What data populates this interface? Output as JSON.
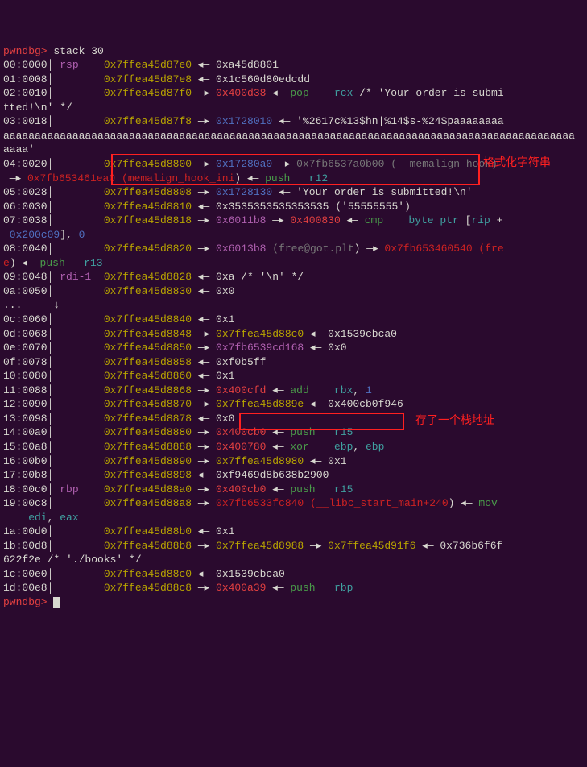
{
  "prompt": "pwndbg>",
  "command": "stack 30",
  "rows": [
    {
      "idx": "00:0000",
      "reg": "rsp",
      "addr": "0x7ffea45d87e0",
      "rest": [
        {
          "t": "◂— ",
          "c": "white"
        },
        {
          "t": "0xa45d8801",
          "c": "white"
        }
      ]
    },
    {
      "idx": "01:0008",
      "reg": "",
      "addr": "0x7ffea45d87e8",
      "rest": [
        {
          "t": "◂— ",
          "c": "white"
        },
        {
          "t": "0x1c560d80edcdd",
          "c": "white"
        }
      ]
    },
    {
      "idx": "02:0010",
      "reg": "",
      "addr": "0x7ffea45d87f0",
      "rest": [
        {
          "t": "—▸ ",
          "c": "white"
        },
        {
          "t": "0x400d38",
          "c": "red"
        },
        {
          "t": " ◂— ",
          "c": "white"
        },
        {
          "t": "pop    ",
          "c": "green"
        },
        {
          "t": "rcx",
          "c": "cyan"
        },
        {
          "t": " /* 'Your order is submi",
          "c": "white"
        }
      ],
      "wrap": "tted!\\n' */"
    },
    {
      "idx": "03:0018",
      "reg": "",
      "addr": "0x7ffea45d87f8",
      "rest": [
        {
          "t": "—▸ ",
          "c": "white"
        },
        {
          "t": "0x1728010",
          "c": "blue"
        },
        {
          "t": " ◂— ",
          "c": "white"
        },
        {
          "t": "'%2617c%13$hn|%14$s-%24$paaaaaaaa",
          "c": "white"
        }
      ],
      "wrap": "aaaaaaaaaaaaaaaaaaaaaaaaaaaaaaaaaaaaaaaaaaaaaaaaaaaaaaaaaaaaaaaaaaaaaaaaaaaaaaaaaaaaaaaaaaa\naaaa'"
    },
    {
      "idx": "04:0020",
      "reg": "",
      "addr": "0x7ffea45d8800",
      "rest": [
        {
          "t": "—▸ ",
          "c": "white"
        },
        {
          "t": "0x17280a0",
          "c": "blue"
        },
        {
          "t": " —▸ ",
          "c": "white"
        },
        {
          "t": "0x7fb6537a0b00",
          "c": "dim"
        },
        {
          "t": " (",
          "c": "dim"
        },
        {
          "t": "__memalign_hook",
          "c": "dim"
        },
        {
          "t": ")",
          "c": "dim"
        }
      ],
      "wrap2": [
        {
          "t": " —▸ ",
          "c": "white"
        },
        {
          "t": "0x7fb653461ea0",
          "c": "darkred"
        },
        {
          "t": " (",
          "c": "darkred"
        },
        {
          "t": "memalign_hook_ini",
          "c": "darkred"
        },
        {
          "t": ") ◂— ",
          "c": "white"
        },
        {
          "t": "push   ",
          "c": "green"
        },
        {
          "t": "r12",
          "c": "cyan"
        }
      ]
    },
    {
      "idx": "05:0028",
      "reg": "",
      "addr": "0x7ffea45d8808",
      "rest": [
        {
          "t": "—▸ ",
          "c": "white"
        },
        {
          "t": "0x1728130",
          "c": "blue"
        },
        {
          "t": " ◂— ",
          "c": "white"
        },
        {
          "t": "'Your order is submitted!\\n'",
          "c": "white"
        }
      ]
    },
    {
      "idx": "06:0030",
      "reg": "",
      "addr": "0x7ffea45d8810",
      "rest": [
        {
          "t": "◂— ",
          "c": "white"
        },
        {
          "t": "0x3535353535353535",
          "c": "white"
        },
        {
          "t": " (",
          "c": "white"
        },
        {
          "t": "'55555555'",
          "c": "white"
        },
        {
          "t": ")",
          "c": "white"
        }
      ]
    },
    {
      "idx": "07:0038",
      "reg": "",
      "addr": "0x7ffea45d8818",
      "rest": [
        {
          "t": "—▸ ",
          "c": "white"
        },
        {
          "t": "0x6011b8",
          "c": "magenta"
        },
        {
          "t": " —▸ ",
          "c": "white"
        },
        {
          "t": "0x400830",
          "c": "red"
        },
        {
          "t": " ◂— ",
          "c": "white"
        },
        {
          "t": "cmp    ",
          "c": "green"
        },
        {
          "t": "byte ptr ",
          "c": "cyan"
        },
        {
          "t": "[",
          "c": "white"
        },
        {
          "t": "rip ",
          "c": "cyan"
        },
        {
          "t": "+",
          "c": "white"
        }
      ],
      "wrap2": [
        {
          "t": " 0x200c09",
          "c": "blue"
        },
        {
          "t": "], ",
          "c": "white"
        },
        {
          "t": "0",
          "c": "blue"
        }
      ]
    },
    {
      "idx": "08:0040",
      "reg": "",
      "addr": "0x7ffea45d8820",
      "rest": [
        {
          "t": "—▸ ",
          "c": "white"
        },
        {
          "t": "0x6013b8",
          "c": "magenta"
        },
        {
          "t": " (",
          "c": "dim"
        },
        {
          "t": "free@got.plt",
          "c": "dim"
        },
        {
          "t": ") —▸ ",
          "c": "white"
        },
        {
          "t": "0x7fb653460540",
          "c": "darkred"
        },
        {
          "t": " (",
          "c": "darkred"
        },
        {
          "t": "fre",
          "c": "darkred"
        }
      ],
      "wrap2": [
        {
          "t": "e",
          "c": "darkred"
        },
        {
          "t": ") ◂— ",
          "c": "white"
        },
        {
          "t": "push   ",
          "c": "green"
        },
        {
          "t": "r13",
          "c": "cyan"
        }
      ]
    },
    {
      "idx": "09:0048",
      "reg": "rdi-1",
      "addr": "0x7ffea45d8828",
      "rest": [
        {
          "t": "◂— ",
          "c": "white"
        },
        {
          "t": "0xa",
          "c": "white"
        },
        {
          "t": " /* '\\n' */",
          "c": "white"
        }
      ]
    },
    {
      "idx": "0a:0050",
      "reg": "",
      "addr": "0x7ffea45d8830",
      "rest": [
        {
          "t": "◂— ",
          "c": "white"
        },
        {
          "t": "0x0",
          "c": "white"
        }
      ]
    },
    {
      "idx": "...",
      "reg": "",
      "addr": "↓",
      "rest": []
    },
    {
      "idx": "0c:0060",
      "reg": "",
      "addr": "0x7ffea45d8840",
      "rest": [
        {
          "t": "◂— ",
          "c": "white"
        },
        {
          "t": "0x1",
          "c": "white"
        }
      ]
    },
    {
      "idx": "0d:0068",
      "reg": "",
      "addr": "0x7ffea45d8848",
      "rest": [
        {
          "t": "—▸ ",
          "c": "white"
        },
        {
          "t": "0x7ffea45d88c0",
          "c": "yellow"
        },
        {
          "t": " ◂— ",
          "c": "white"
        },
        {
          "t": "0x1539cbca0",
          "c": "white"
        }
      ]
    },
    {
      "idx": "0e:0070",
      "reg": "",
      "addr": "0x7ffea45d8850",
      "rest": [
        {
          "t": "—▸ ",
          "c": "white"
        },
        {
          "t": "0x7fb6539cd168",
          "c": "magenta"
        },
        {
          "t": " ◂— ",
          "c": "white"
        },
        {
          "t": "0x0",
          "c": "white"
        }
      ]
    },
    {
      "idx": "0f:0078",
      "reg": "",
      "addr": "0x7ffea45d8858",
      "rest": [
        {
          "t": "◂— ",
          "c": "white"
        },
        {
          "t": "0xf0b5ff",
          "c": "white"
        }
      ]
    },
    {
      "idx": "10:0080",
      "reg": "",
      "addr": "0x7ffea45d8860",
      "rest": [
        {
          "t": "◂— ",
          "c": "white"
        },
        {
          "t": "0x1",
          "c": "white"
        }
      ]
    },
    {
      "idx": "11:0088",
      "reg": "",
      "addr": "0x7ffea45d8868",
      "rest": [
        {
          "t": "—▸ ",
          "c": "white"
        },
        {
          "t": "0x400cfd",
          "c": "red"
        },
        {
          "t": " ◂— ",
          "c": "white"
        },
        {
          "t": "add    ",
          "c": "green"
        },
        {
          "t": "rbx",
          "c": "cyan"
        },
        {
          "t": ", ",
          "c": "white"
        },
        {
          "t": "1",
          "c": "blue"
        }
      ]
    },
    {
      "idx": "12:0090",
      "reg": "",
      "addr": "0x7ffea45d8870",
      "rest": [
        {
          "t": "—▸ ",
          "c": "white"
        },
        {
          "t": "0x7ffea45d889e",
          "c": "yellow"
        },
        {
          "t": " ◂— ",
          "c": "white"
        },
        {
          "t": "0x400cb0f946",
          "c": "white"
        }
      ]
    },
    {
      "idx": "13:0098",
      "reg": "",
      "addr": "0x7ffea45d8878",
      "rest": [
        {
          "t": "◂— ",
          "c": "white"
        },
        {
          "t": "0x0",
          "c": "white"
        }
      ]
    },
    {
      "idx": "14:00a0",
      "reg": "",
      "addr": "0x7ffea45d8880",
      "rest": [
        {
          "t": "—▸ ",
          "c": "white"
        },
        {
          "t": "0x400cb0",
          "c": "red"
        },
        {
          "t": " ◂— ",
          "c": "white"
        },
        {
          "t": "push   ",
          "c": "green"
        },
        {
          "t": "r15",
          "c": "cyan"
        }
      ]
    },
    {
      "idx": "15:00a8",
      "reg": "",
      "addr": "0x7ffea45d8888",
      "rest": [
        {
          "t": "—▸ ",
          "c": "white"
        },
        {
          "t": "0x400780",
          "c": "red"
        },
        {
          "t": " ◂— ",
          "c": "white"
        },
        {
          "t": "xor    ",
          "c": "green"
        },
        {
          "t": "ebp",
          "c": "cyan"
        },
        {
          "t": ", ",
          "c": "white"
        },
        {
          "t": "ebp",
          "c": "cyan"
        }
      ]
    },
    {
      "idx": "16:00b0",
      "reg": "",
      "addr": "0x7ffea45d8890",
      "rest": [
        {
          "t": "—▸ ",
          "c": "white"
        },
        {
          "t": "0x7ffea45d8980",
          "c": "yellow"
        },
        {
          "t": " ◂— ",
          "c": "white"
        },
        {
          "t": "0x1",
          "c": "white"
        }
      ]
    },
    {
      "idx": "17:00b8",
      "reg": "",
      "addr": "0x7ffea45d8898",
      "rest": [
        {
          "t": "◂— ",
          "c": "white"
        },
        {
          "t": "0xf9469d8b638b2900",
          "c": "white"
        }
      ]
    },
    {
      "idx": "18:00c0",
      "reg": "rbp",
      "addr": "0x7ffea45d88a0",
      "rest": [
        {
          "t": "—▸ ",
          "c": "white"
        },
        {
          "t": "0x400cb0",
          "c": "red"
        },
        {
          "t": " ◂— ",
          "c": "white"
        },
        {
          "t": "push   ",
          "c": "green"
        },
        {
          "t": "r15",
          "c": "cyan"
        }
      ]
    },
    {
      "idx": "19:00c8",
      "reg": "",
      "addr": "0x7ffea45d88a8",
      "rest": [
        {
          "t": "—▸ ",
          "c": "white"
        },
        {
          "t": "0x7fb6533fc840",
          "c": "darkred"
        },
        {
          "t": " (",
          "c": "darkred"
        },
        {
          "t": "__libc_start_main+240",
          "c": "darkred"
        },
        {
          "t": ") ◂— ",
          "c": "white"
        },
        {
          "t": "mov",
          "c": "green"
        }
      ],
      "wrap2": [
        {
          "t": "    edi",
          "c": "cyan"
        },
        {
          "t": ", ",
          "c": "white"
        },
        {
          "t": "eax",
          "c": "cyan"
        }
      ]
    },
    {
      "idx": "1a:00d0",
      "reg": "",
      "addr": "0x7ffea45d88b0",
      "rest": [
        {
          "t": "◂— ",
          "c": "white"
        },
        {
          "t": "0x1",
          "c": "white"
        }
      ]
    },
    {
      "idx": "1b:00d8",
      "reg": "",
      "addr": "0x7ffea45d88b8",
      "rest": [
        {
          "t": "—▸ ",
          "c": "white"
        },
        {
          "t": "0x7ffea45d8988",
          "c": "yellow"
        },
        {
          "t": " —▸ ",
          "c": "white"
        },
        {
          "t": "0x7ffea45d91f6",
          "c": "yellow"
        },
        {
          "t": " ◂— ",
          "c": "white"
        },
        {
          "t": "0x736b6f6f",
          "c": "white"
        }
      ],
      "wrap": "622f2e /* './books' */"
    },
    {
      "idx": "1c:00e0",
      "reg": "",
      "addr": "0x7ffea45d88c0",
      "rest": [
        {
          "t": "◂— ",
          "c": "white"
        },
        {
          "t": "0x1539cbca0",
          "c": "white"
        }
      ]
    },
    {
      "idx": "1d:00e8",
      "reg": "",
      "addr": "0x7ffea45d88c8",
      "rest": [
        {
          "t": "—▸ ",
          "c": "white"
        },
        {
          "t": "0x400a39",
          "c": "red"
        },
        {
          "t": " ◂— ",
          "c": "white"
        },
        {
          "t": "push   ",
          "c": "green"
        },
        {
          "t": "rbp",
          "c": "cyan"
        }
      ]
    }
  ],
  "annotations": {
    "a1": "格式化字符串",
    "a2": "存了一个栈地址"
  }
}
